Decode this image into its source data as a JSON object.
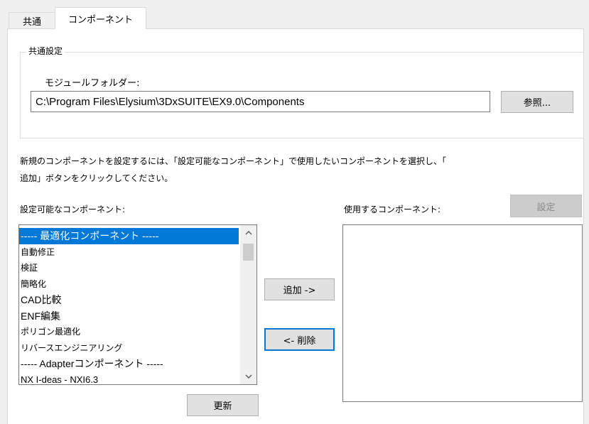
{
  "tabs": [
    {
      "label": "共通"
    },
    {
      "label": "コンポーネント"
    }
  ],
  "common_settings": {
    "group_title": "共通設定",
    "module_folder_label": "モジュールフォルダー:",
    "module_folder_value": "C:\\Program Files\\Elysium\\3DxSUITE\\EX9.0\\Components",
    "browse_label": "参照..."
  },
  "instruction": {
    "line1": "新規のコンポーネントを設定するには、「設定可能なコンポーネント」で使用したいコンポーネントを選択し、「",
    "line2": "追加」ボタンをクリックしてください。"
  },
  "available": {
    "label": "設定可能なコンポーネント:",
    "items": [
      "----- 最適化コンポーネント -----",
      "自動修正",
      "検証",
      "簡略化",
      "CAD比較",
      "ENF編集",
      "ポリゴン最適化",
      "リバースエンジニアリング",
      "----- Adapterコンポーネント -----",
      "NX I-deas - NXI6.3"
    ],
    "selected_index": 0
  },
  "used": {
    "label": "使用するコンポーネント:",
    "settings_label": "設定"
  },
  "buttons": {
    "add": "追加 ->",
    "remove": "<- 削除",
    "refresh": "更新"
  },
  "scroll_icons": {
    "up": "chevron-up-icon",
    "down": "chevron-down-icon"
  }
}
